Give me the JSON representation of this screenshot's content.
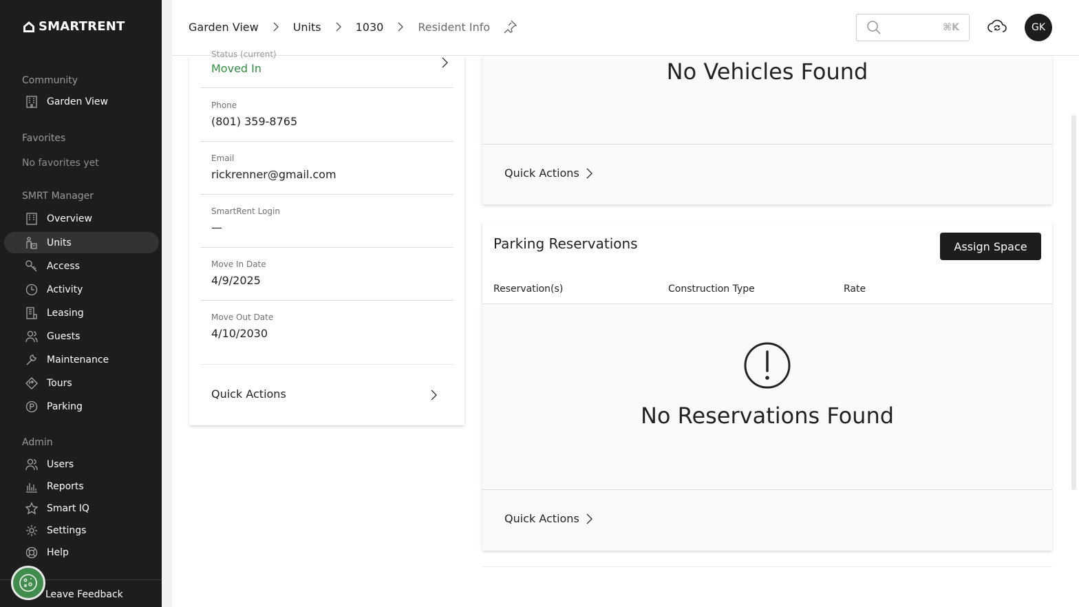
{
  "sidebar": {
    "logo": "SMARTRENT",
    "community": {
      "title": "Community",
      "item": "Garden View"
    },
    "favorites": {
      "title": "Favorites",
      "empty": "No favorites yet"
    },
    "smrt_manager": {
      "title": "SMRT Manager",
      "items": [
        "Overview",
        "Units",
        "Access",
        "Activity",
        "Leasing",
        "Guests",
        "Maintenance",
        "Tours",
        "Parking"
      ]
    },
    "admin": {
      "title": "Admin",
      "items": [
        "Users",
        "Reports",
        "Smart IQ",
        "Settings",
        "Help"
      ]
    },
    "feedback": "Leave Feedback"
  },
  "header": {
    "breadcrumbs": [
      "Garden View",
      "Units",
      "1030",
      "Resident Info"
    ],
    "search_shortcut": "⌘K",
    "avatar_initials": "GK"
  },
  "resident": {
    "status_label": "Status (current)",
    "status_value": "Moved In",
    "phone_label": "Phone",
    "phone_value": "(801) 359-8765",
    "email_label": "Email",
    "email_value": "rickrenner@gmail.com",
    "login_label": "SmartRent Login",
    "login_value": "—",
    "movein_label": "Move In Date",
    "movein_value": "4/9/2025",
    "moveout_label": "Move Out Date",
    "moveout_value": "4/10/2030",
    "quick_actions": "Quick Actions"
  },
  "vehicles": {
    "empty": "No Vehicles Found",
    "quick_actions": "Quick Actions"
  },
  "parking": {
    "title": "Parking Reservations",
    "assign_button": "Assign Space",
    "columns": [
      "Reservation(s)",
      "Construction Type",
      "Rate"
    ],
    "empty": "No Reservations Found",
    "quick_actions": "Quick Actions"
  },
  "colors": {
    "sidebar_bg": "#1d1d1d",
    "status_green": "#2f8f3f",
    "feedback_green": "#3f8c4d"
  }
}
